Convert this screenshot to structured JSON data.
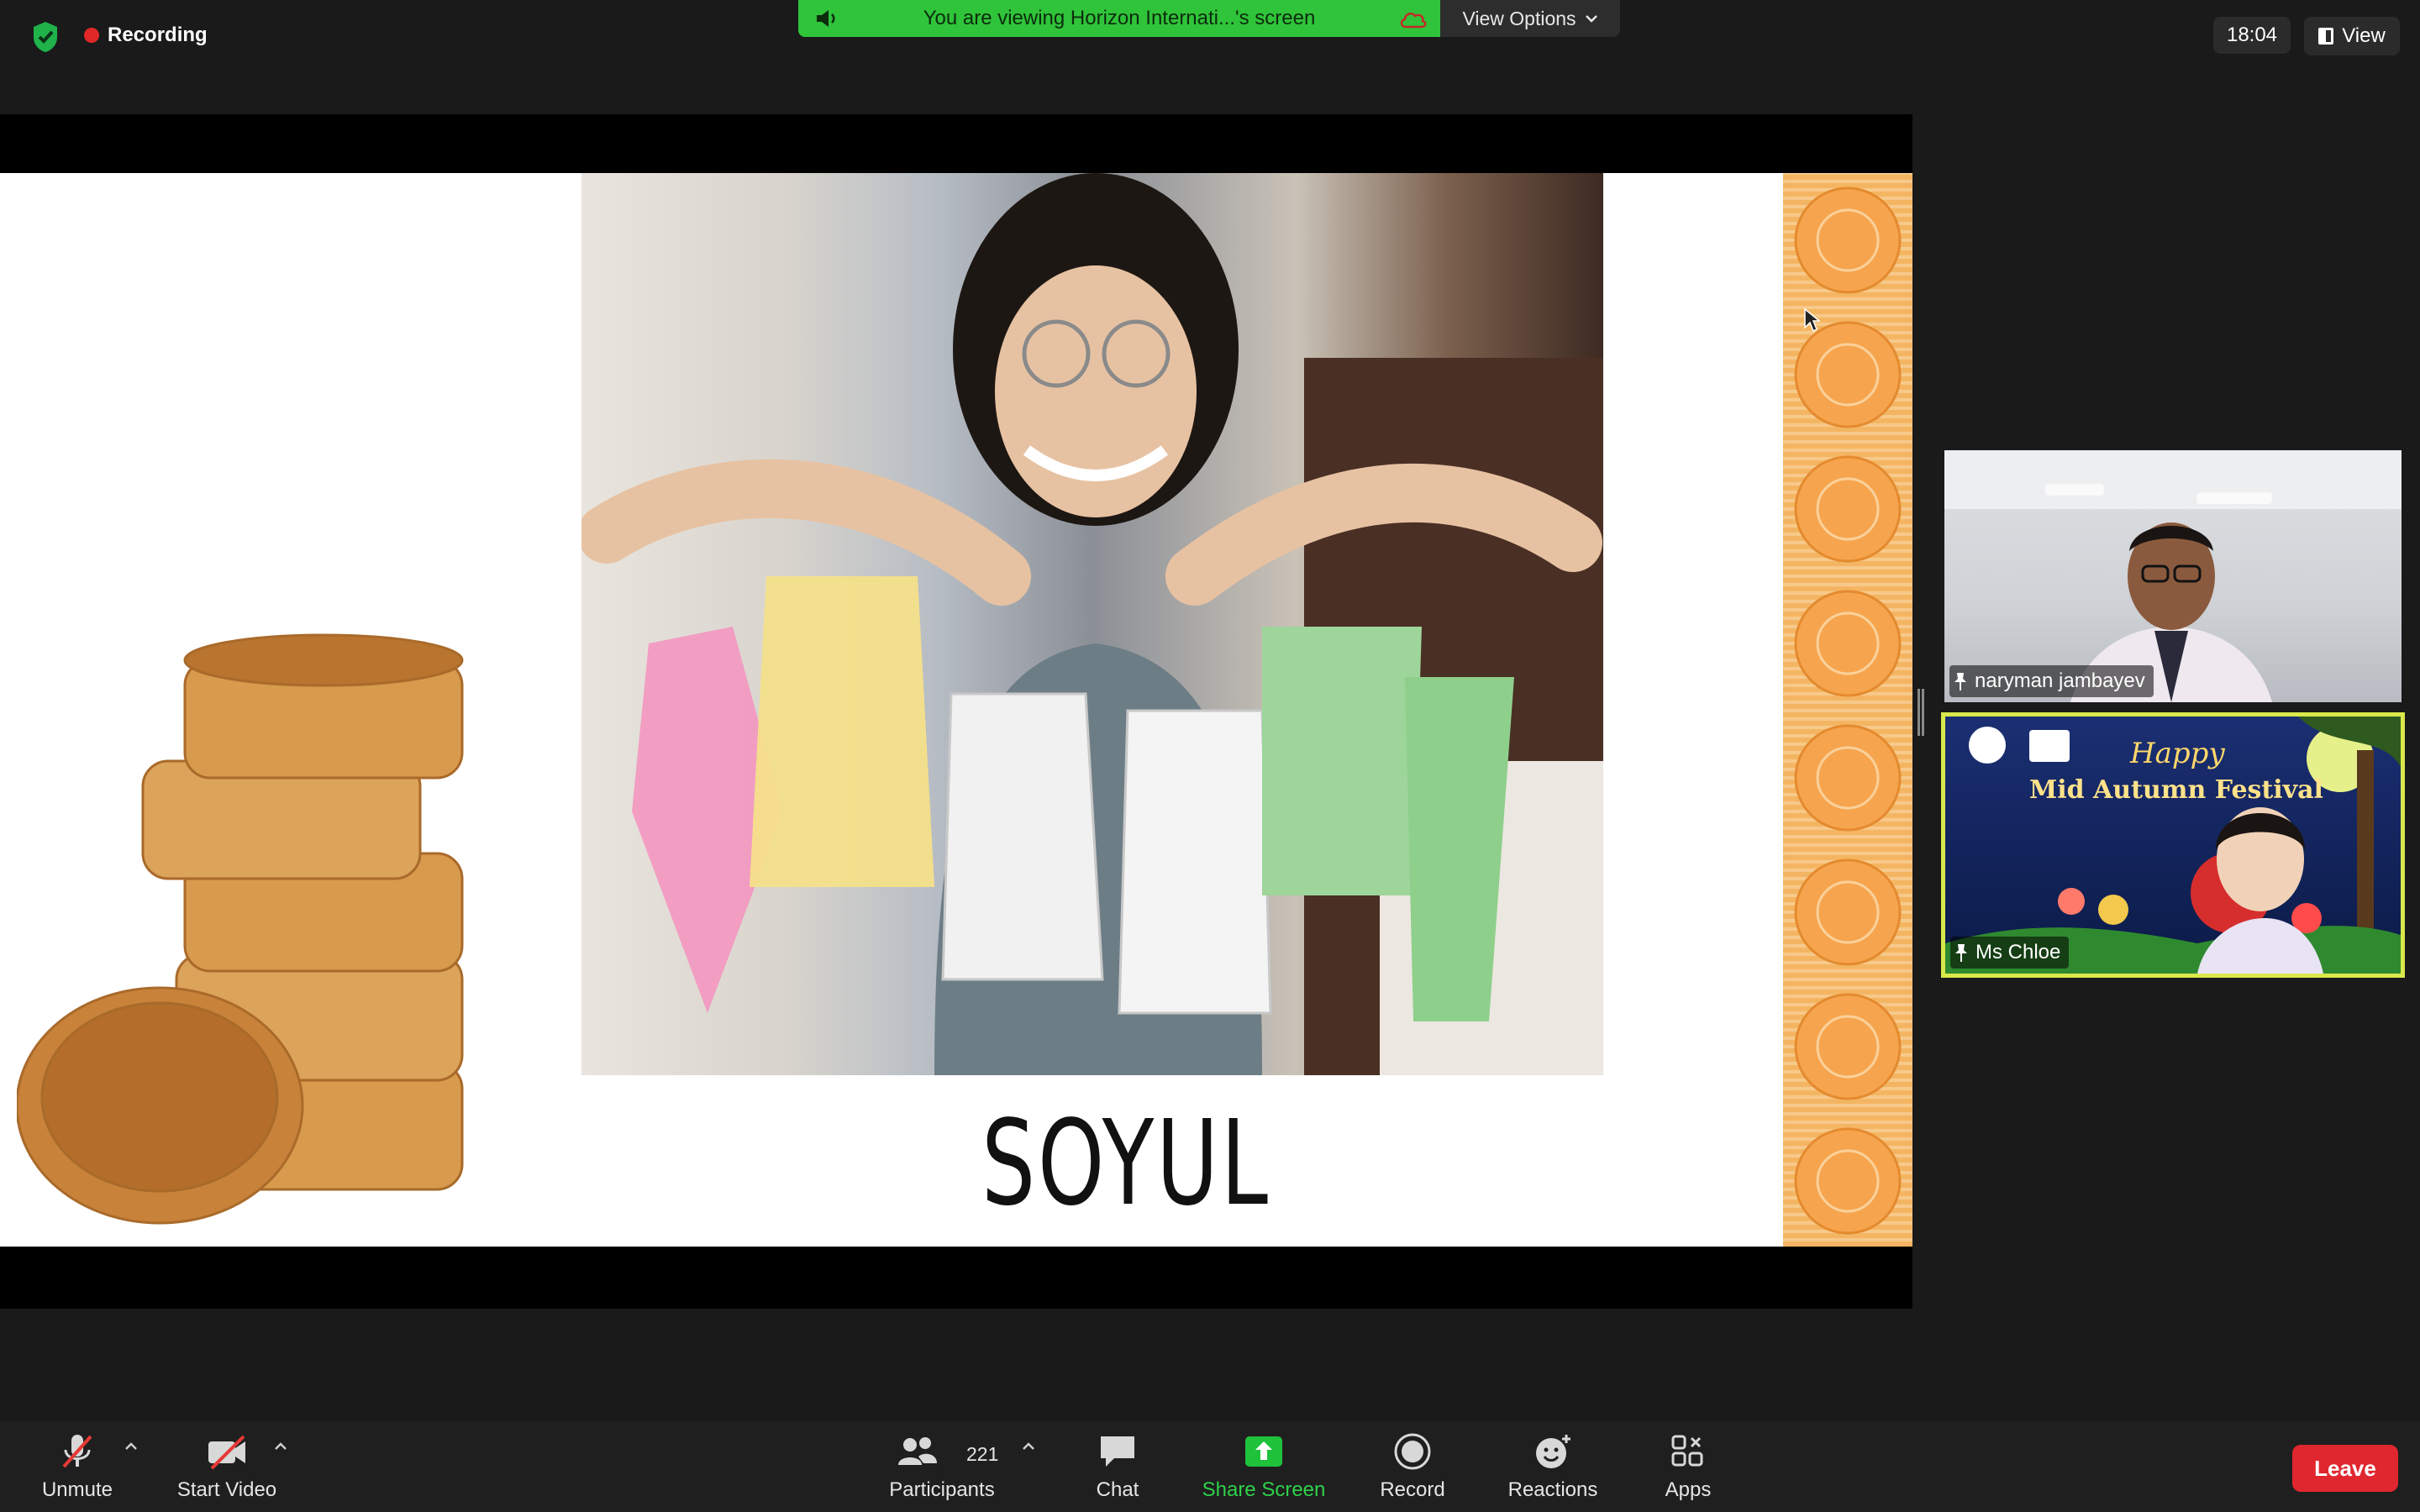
{
  "recording": {
    "label": "Recording"
  },
  "share_banner": {
    "text": "You are viewing Horizon Internati...'s screen",
    "view_options": "View Options"
  },
  "clock": "18:04",
  "view_button": "View",
  "slide": {
    "caption": "SOYUL"
  },
  "participants": [
    {
      "name": "naryman jambayev"
    },
    {
      "name": "Ms Chloe",
      "banner_text_1": "Happy",
      "banner_text_2": "Mid Autumn Festival"
    }
  ],
  "toolbar": {
    "unmute": "Unmute",
    "start_video": "Start Video",
    "participants": "Participants",
    "participants_count": "221",
    "chat": "Chat",
    "share_screen": "Share Screen",
    "record": "Record",
    "reactions": "Reactions",
    "apps": "Apps",
    "leave": "Leave"
  },
  "colors": {
    "accent_green": "#2fc43a",
    "leave_red": "#e0262f",
    "active_speaker_border": "#d9e84a",
    "share_icon_green": "#1ec23b"
  }
}
